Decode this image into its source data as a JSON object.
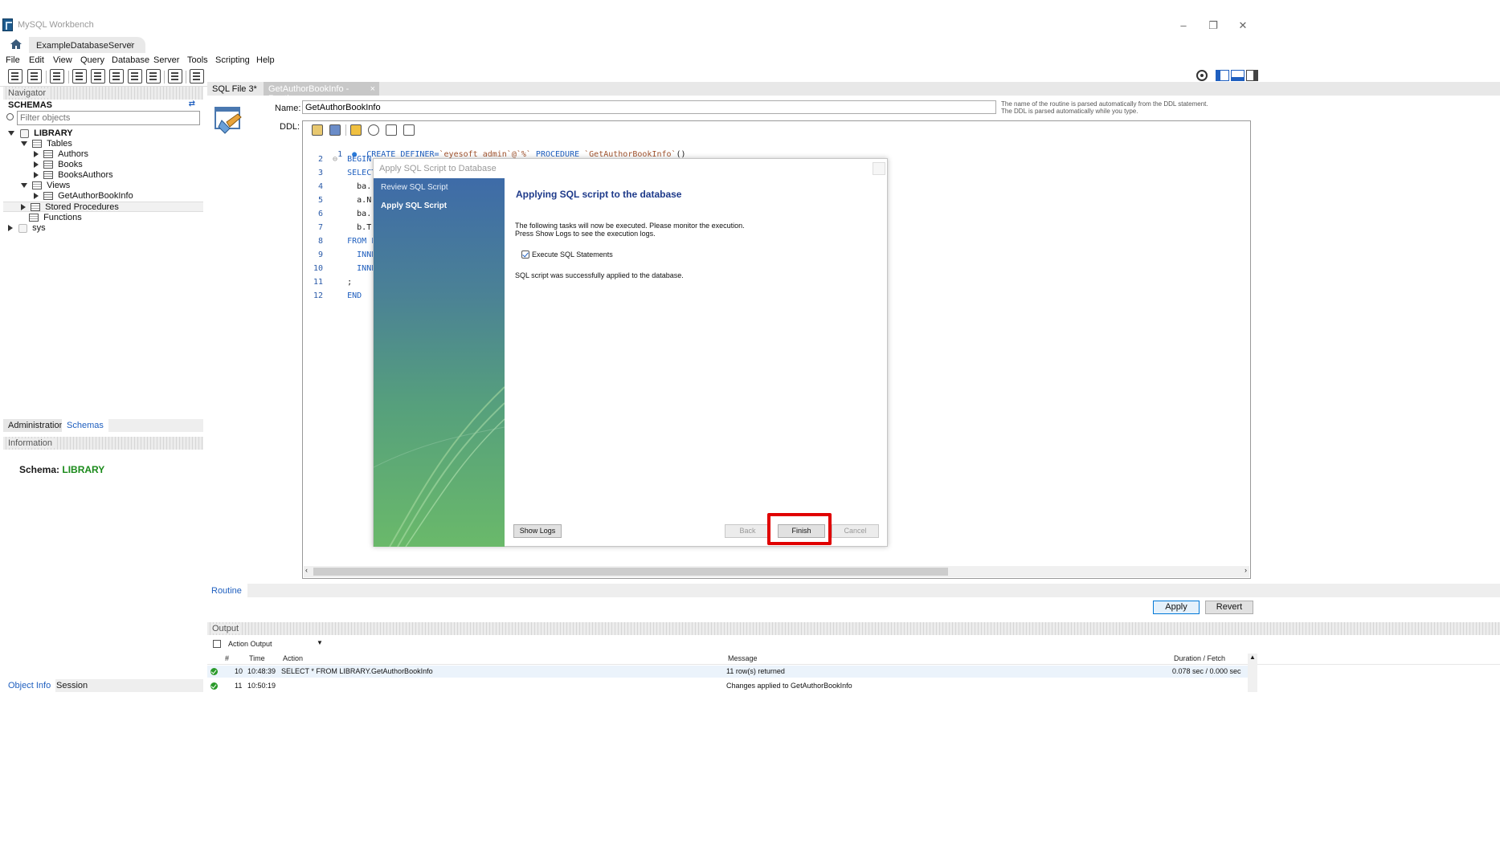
{
  "window": {
    "title": "MySQL Workbench",
    "minimize": "–",
    "restore": "❐",
    "close": "✕"
  },
  "connection_tab": {
    "label": "ExampleDatabaseServer",
    "close": "×"
  },
  "menu": [
    "File",
    "Edit",
    "View",
    "Query",
    "Database",
    "Server",
    "Tools",
    "Scripting",
    "Help"
  ],
  "navigator": {
    "header": "Navigator",
    "schemas_label": "SCHEMAS",
    "filter_placeholder": "Filter objects",
    "tree": {
      "library": "LIBRARY",
      "tables": "Tables",
      "authors": "Authors",
      "books": "Books",
      "booksauthors": "BooksAuthors",
      "views": "Views",
      "view1": "GetAuthorBookInfo",
      "stored_procedures": "Stored Procedures",
      "functions": "Functions",
      "sys": "sys"
    },
    "tabs": {
      "administration": "Administration",
      "schemas": "Schemas"
    }
  },
  "information": {
    "header": "Information",
    "schema_label": "Schema:",
    "schema_value": "LIBRARY"
  },
  "bottom_tabs": {
    "object_info": "Object Info",
    "session": "Session"
  },
  "editor": {
    "tabs": {
      "sql_file": "SQL File 3*",
      "routine": "GetAuthorBookInfo - Routine",
      "close": "×"
    },
    "name_label": "Name:",
    "name_value": "GetAuthorBookInfo",
    "hint": "The name of the routine is parsed automatically from the DDL statement. The DDL is parsed automatically while you type.",
    "ddl_label": "DDL:",
    "code": {
      "l1_num": "1",
      "l1_kw1": "CREATE DEFINER=",
      "l1_str": "`eyesoft_admin`@`%`",
      "l1_kw2": " PROCEDURE ",
      "l1_str2": "`GetAuthorBookInfo`",
      "l1_rest": "()",
      "l2_num": "2",
      "l2": "BEGIN",
      "l3_num": "3",
      "l3": "SELECT",
      "l4_num": "4",
      "l4": "ba.",
      "l5_num": "5",
      "l5": "a.N",
      "l6_num": "6",
      "l6": "ba.",
      "l7_num": "7",
      "l7": "b.T",
      "l8_num": "8",
      "l8": "FROM L",
      "l9_num": "9",
      "l9": "INNE",
      "l10_num": "10",
      "l10": "INNE",
      "l11_num": "11",
      "l11": ";",
      "l12_num": "12",
      "l12": "END"
    },
    "bottom_tab": "Routine",
    "apply": "Apply",
    "revert": "Revert"
  },
  "output": {
    "header": "Output",
    "selector": "Action Output",
    "columns": {
      "hash": "#",
      "time": "Time",
      "action": "Action",
      "message": "Message",
      "duration": "Duration / Fetch"
    },
    "rows": [
      {
        "num": "10",
        "time": "10:48:39",
        "action": "SELECT * FROM LIBRARY.GetAuthorBookInfo",
        "message": "11 row(s) returned",
        "duration": "0.078 sec / 0.000 sec"
      },
      {
        "num": "11",
        "time": "10:50:19",
        "action": "",
        "message": "Changes applied to GetAuthorBookInfo",
        "duration": ""
      }
    ]
  },
  "dialog": {
    "title": "Apply SQL Script to Database",
    "steps": [
      "Review SQL Script",
      "Apply SQL Script"
    ],
    "heading": "Applying SQL script to the database",
    "text1": "The following tasks will now be executed. Please monitor the execution.",
    "text2": "Press Show Logs to see the execution logs.",
    "task": "Execute SQL Statements",
    "result": "SQL script was successfully applied to the database.",
    "show_logs": "Show Logs",
    "back": "Back",
    "finish": "Finish",
    "cancel": "Cancel"
  },
  "colors": {
    "highlight": "#e00000",
    "dialog_heading": "#1e3a8a",
    "schema_value": "#1a8a1a",
    "keyword": "#1f5fbf"
  }
}
